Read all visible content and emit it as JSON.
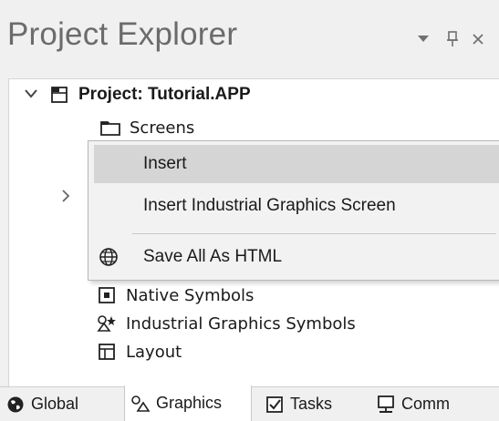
{
  "panel": {
    "title": "Project Explorer",
    "buttons": [
      {
        "name": "dropdown-icon",
        "glyph": "▼"
      },
      {
        "name": "pin-icon",
        "glyph": "Ḥ"
      },
      {
        "name": "close-icon",
        "glyph": "×"
      }
    ]
  },
  "tree": {
    "root_label": "Project: Tutorial.APP",
    "items": [
      {
        "label": "Screens",
        "icon": "folder-icon"
      },
      {
        "label": "Native Symbols",
        "icon": "native-symbols-icon"
      },
      {
        "label": "Industrial Graphics Symbols",
        "icon": "industrial-graphics-symbols-icon"
      },
      {
        "label": "Layout",
        "icon": "layout-icon"
      }
    ]
  },
  "context_menu": {
    "items": [
      {
        "label": "Insert",
        "highlighted": true,
        "icon": ""
      },
      {
        "label": "Insert Industrial Graphics Screen",
        "highlighted": false,
        "icon": ""
      },
      {
        "label": "Save All As HTML",
        "highlighted": false,
        "icon": "globe-icon"
      }
    ]
  },
  "tabs": [
    {
      "label": "Global",
      "icon": "global-icon",
      "active": false
    },
    {
      "label": "Graphics",
      "icon": "graphics-icon",
      "active": true
    },
    {
      "label": "Tasks",
      "icon": "tasks-icon",
      "active": false
    },
    {
      "label": "Comm",
      "icon": "comm-icon",
      "active": false
    }
  ],
  "colors": {
    "panel_bg": "#f0f0f0",
    "tree_bg": "#ffffff",
    "menu_bg": "#f2f2f2",
    "menu_highlight": "#d5d5d5",
    "title_text": "#6b6b6b"
  }
}
